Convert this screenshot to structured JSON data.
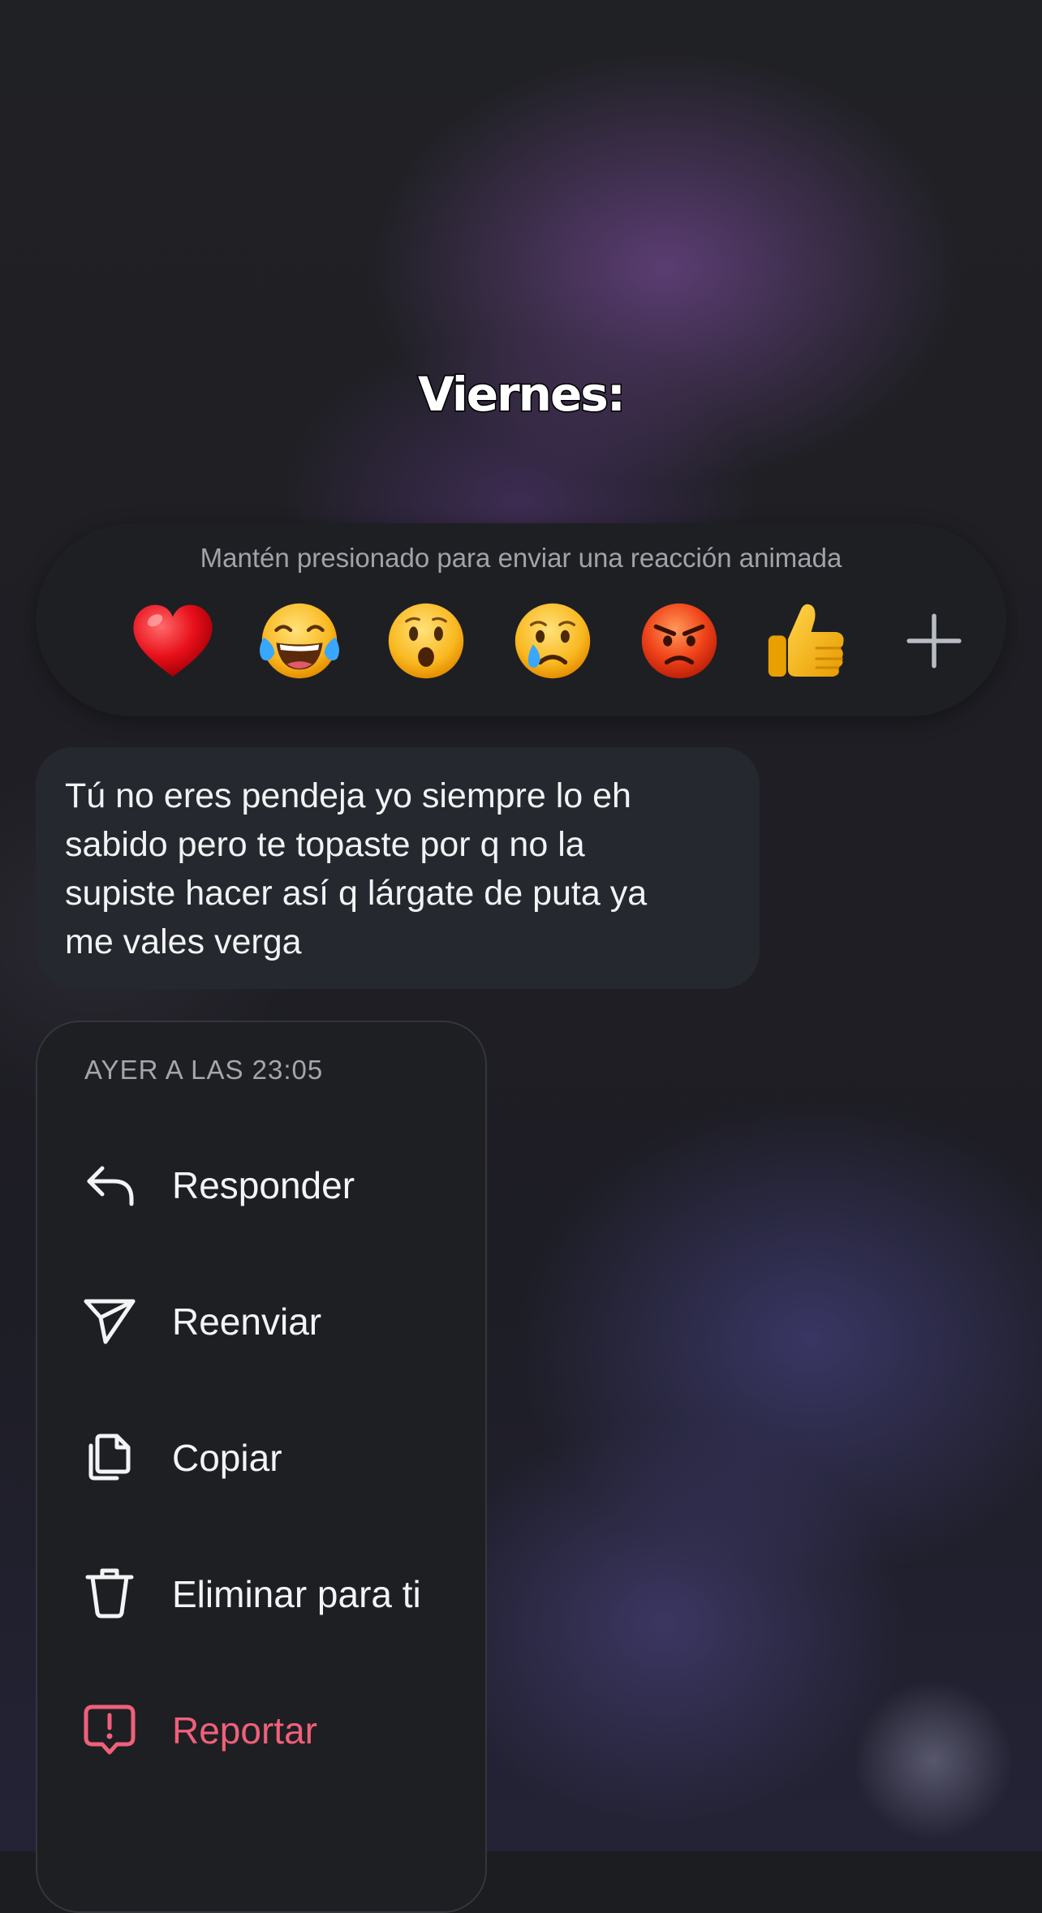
{
  "overlay": {
    "title": "Viernes:"
  },
  "reaction_bar": {
    "hint": "Mantén presionado para enviar una reacción animada",
    "emojis": [
      {
        "name": "red-heart",
        "char": "❤️"
      },
      {
        "name": "face-with-tears-of-joy",
        "char": "😂"
      },
      {
        "name": "face-with-open-mouth",
        "char": "😮"
      },
      {
        "name": "crying-face",
        "char": "😢"
      },
      {
        "name": "pouting-face",
        "char": "😡"
      },
      {
        "name": "thumbs-up",
        "char": "👍"
      }
    ],
    "more_icon": "plus-icon"
  },
  "message": {
    "text": "Tú no eres pendeja yo siempre lo eh\nsabido pero te topaste por q no la\nsupiste hacer así q lárgate de puta ya\nme vales verga"
  },
  "context_menu": {
    "timestamp": "AYER A LAS 23:05",
    "items": [
      {
        "label": "Responder",
        "icon": "reply-icon"
      },
      {
        "label": "Reenviar",
        "icon": "send-icon"
      },
      {
        "label": "Copiar",
        "icon": "copy-icon"
      },
      {
        "label": "Eliminar para ti",
        "icon": "trash-icon"
      },
      {
        "label": "Reportar",
        "icon": "report-icon"
      }
    ]
  },
  "colors": {
    "danger": "#f0607a",
    "bubble": "#25282e",
    "menu_bg": "#1e1f23"
  }
}
